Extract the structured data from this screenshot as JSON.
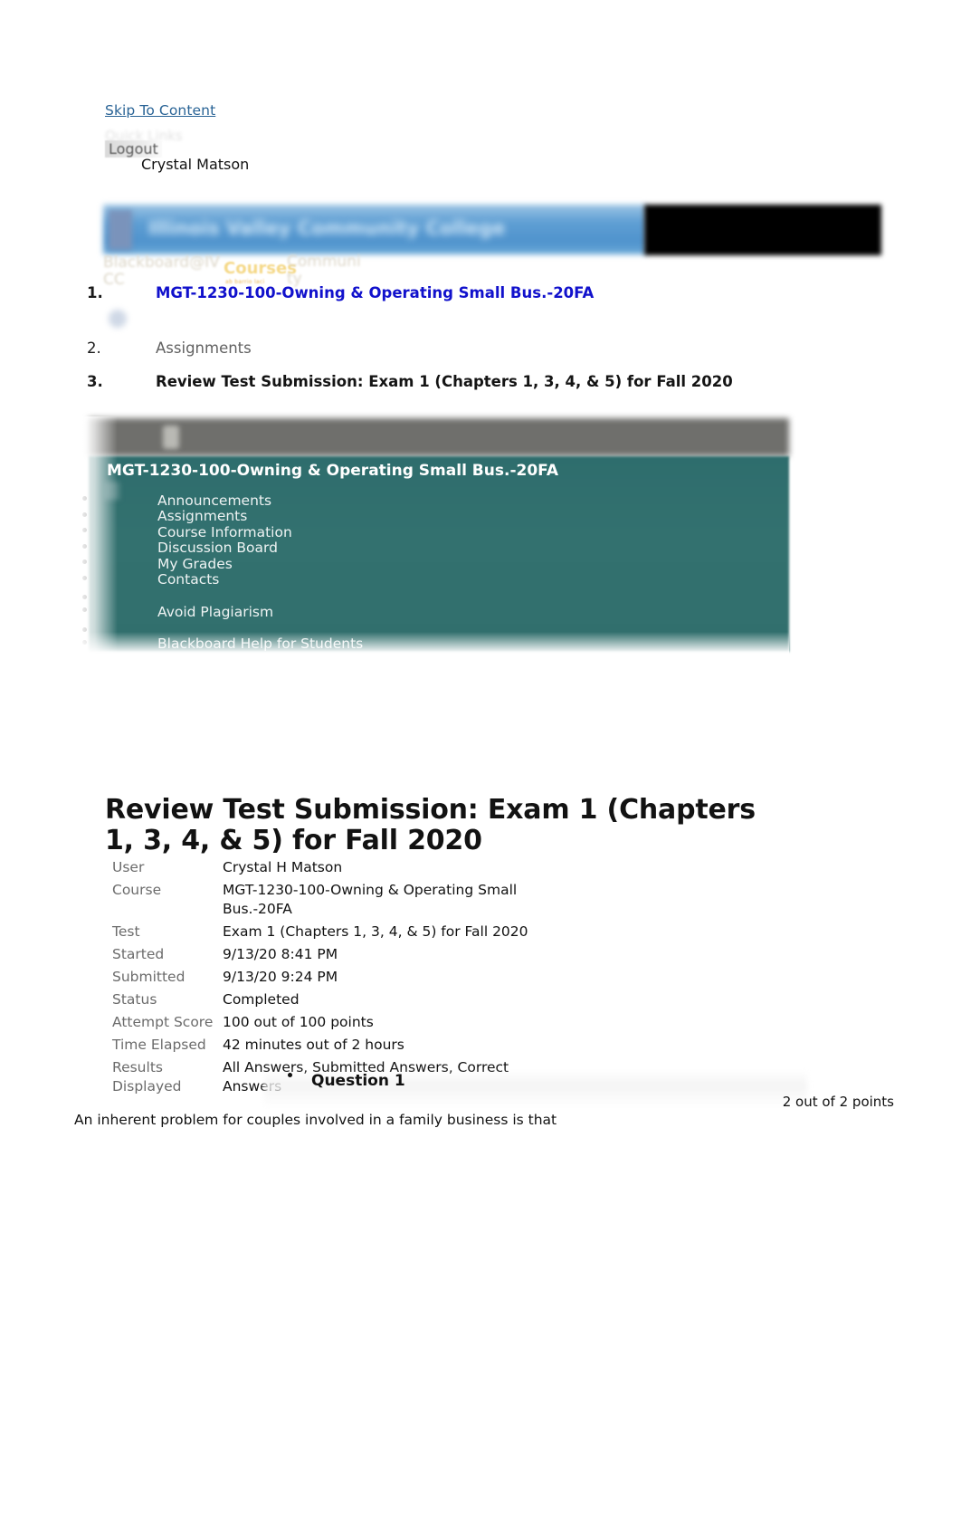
{
  "top_bar": {
    "skip_to_content": "Skip To Content",
    "quick_links": "Quick Links",
    "logout": "Logout",
    "user_name": "Crystal Matson"
  },
  "banner": {
    "institution": "Illinois Valley Community College"
  },
  "global_nav": {
    "blackboard_tab": "Blackboard@IVCC",
    "blackboard_tab_line1": "Blackboard@IV",
    "blackboard_tab_line2": "CC",
    "courses_tab": "Courses",
    "courses_tab_sub": "ab barrio laci",
    "community_tab_line1": "Communi",
    "community_tab_line2": "ty"
  },
  "breadcrumb": {
    "items": [
      {
        "number": "1.",
        "label": "MGT-1230-100-Owning & Operating Small Bus.-20FA"
      },
      {
        "number": "2.",
        "label": "Assignments"
      },
      {
        "number": "3.",
        "label": "Review Test Submission: Exam 1 (Chapters 1, 3, 4, & 5) for Fall 2020"
      }
    ]
  },
  "course_menu": {
    "title": "MGT-1230-100-Owning & Operating Small Bus.-20FA",
    "items": [
      "Announcements",
      "Assignments",
      "Course Information",
      "Discussion Board",
      "My Grades",
      "Contacts",
      "Avoid Plagiarism",
      "Blackboard Help for Students"
    ]
  },
  "document": {
    "title": "Review Test Submission: Exam 1 (Chapters 1, 3, 4, & 5) for Fall 2020",
    "details": [
      {
        "label": "User",
        "value": "Crystal H Matson"
      },
      {
        "label": "Course",
        "value": "MGT-1230-100-Owning & Operating Small Bus.-20FA"
      },
      {
        "label": "Test",
        "value": "Exam 1 (Chapters 1, 3, 4, & 5) for Fall 2020"
      },
      {
        "label": "Started",
        "value": "9/13/20 8:41 PM"
      },
      {
        "label": "Submitted",
        "value": "9/13/20 9:24 PM"
      },
      {
        "label": "Status",
        "value": "Completed"
      },
      {
        "label": "Attempt Score",
        "value": "100 out of 100 points"
      },
      {
        "label": "Time Elapsed",
        "value": "42 minutes out of 2 hours"
      },
      {
        "label": "Results Displayed",
        "value": "All Answers, Submitted Answers, Correct Answers"
      }
    ]
  },
  "question": {
    "title": "Question 1",
    "points": "2 out of 2 points",
    "text": "An inherent problem for couples involved in a family business is that"
  },
  "colors": {
    "link_blue": "#2a6496",
    "crumb_link_blue": "#1111cc",
    "menu_teal": "#316f6d",
    "courses_gold": "#f5d98a"
  }
}
